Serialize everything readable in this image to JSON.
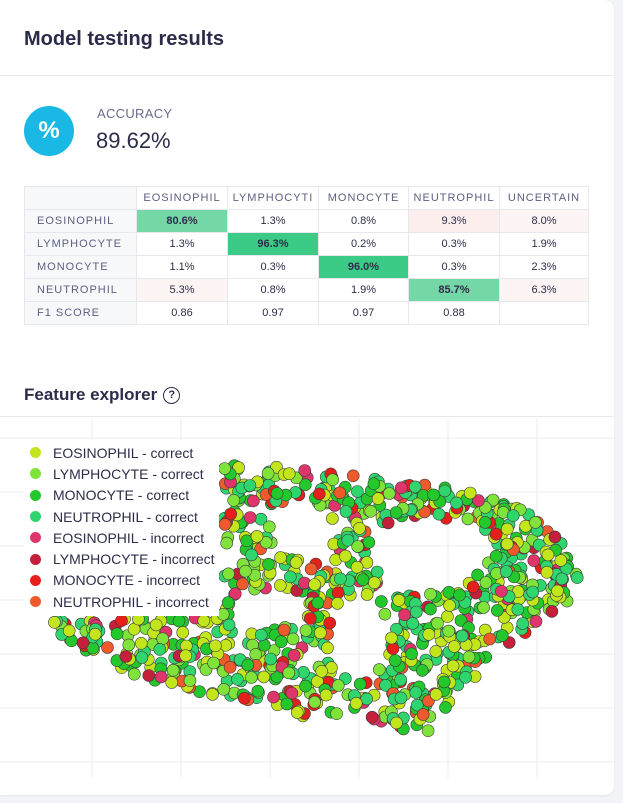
{
  "header": {
    "title": "Model testing results"
  },
  "accuracy": {
    "icon": "percent-icon",
    "badge_symbol": "%",
    "label": "ACCURACY",
    "value": "89.62%"
  },
  "confusion_matrix": {
    "columns": [
      "EOSINOPHIL",
      "LYMPHOCYTE",
      "MONOCYTE",
      "NEUTROPHIL",
      "UNCERTAIN"
    ],
    "columns_visible": [
      "EOSINOPHIL",
      "LYMPHOCYTI",
      "MONOCYTE",
      "NEUTROPHIL",
      "UNCERTAIN"
    ],
    "rows": [
      {
        "label": "EOSINOPHIL",
        "cells": [
          "80.6%",
          "1.3%",
          "0.8%",
          "9.3%",
          "8.0%"
        ]
      },
      {
        "label": "LYMPHOCYTE",
        "cells": [
          "1.3%",
          "96.3%",
          "0.2%",
          "0.3%",
          "1.9%"
        ]
      },
      {
        "label": "MONOCYTE",
        "cells": [
          "1.1%",
          "0.3%",
          "96.0%",
          "0.3%",
          "2.3%"
        ]
      },
      {
        "label": "NEUTROPHIL",
        "cells": [
          "5.3%",
          "0.8%",
          "1.9%",
          "85.7%",
          "6.3%"
        ]
      },
      {
        "label": "F1 SCORE",
        "cells": [
          "0.86",
          "0.97",
          "0.97",
          "0.88",
          ""
        ]
      }
    ]
  },
  "feature_explorer": {
    "title": "Feature explorer",
    "help_icon": "question-circle-icon",
    "legend": [
      {
        "label": "EOSINOPHIL - correct",
        "color": "#c3e51c"
      },
      {
        "label": "LYMPHOCYTE - correct",
        "color": "#7fe33a"
      },
      {
        "label": "MONOCYTE - correct",
        "color": "#22c82c"
      },
      {
        "label": "NEUTROPHIL - correct",
        "color": "#2fd66e"
      },
      {
        "label": "EOSINOPHIL - incorrect",
        "color": "#e0356b"
      },
      {
        "label": "LYMPHOCYTE - incorrect",
        "color": "#c41f3b"
      },
      {
        "label": "MONOCYTE - incorrect",
        "color": "#e5201c"
      },
      {
        "label": "NEUTROPHIL - incorrect",
        "color": "#ef5a2c"
      }
    ]
  },
  "chart_data": {
    "type": "scatter",
    "title": "",
    "xlabel": "",
    "ylabel": "",
    "grid": true,
    "legend_position": "top-left",
    "series": [
      {
        "name": "EOSINOPHIL - correct",
        "color": "#c3e51c"
      },
      {
        "name": "LYMPHOCYTE - correct",
        "color": "#7fe33a"
      },
      {
        "name": "MONOCYTE - correct",
        "color": "#22c82c"
      },
      {
        "name": "NEUTROPHIL - correct",
        "color": "#2fd66e"
      },
      {
        "name": "EOSINOPHIL - incorrect",
        "color": "#e0356b"
      },
      {
        "name": "LYMPHOCYTE - incorrect",
        "color": "#c41f3b"
      },
      {
        "name": "MONOCYTE - incorrect",
        "color": "#e5201c"
      },
      {
        "name": "NEUTROPHIL - incorrect",
        "color": "#ef5a2c"
      }
    ]
  }
}
